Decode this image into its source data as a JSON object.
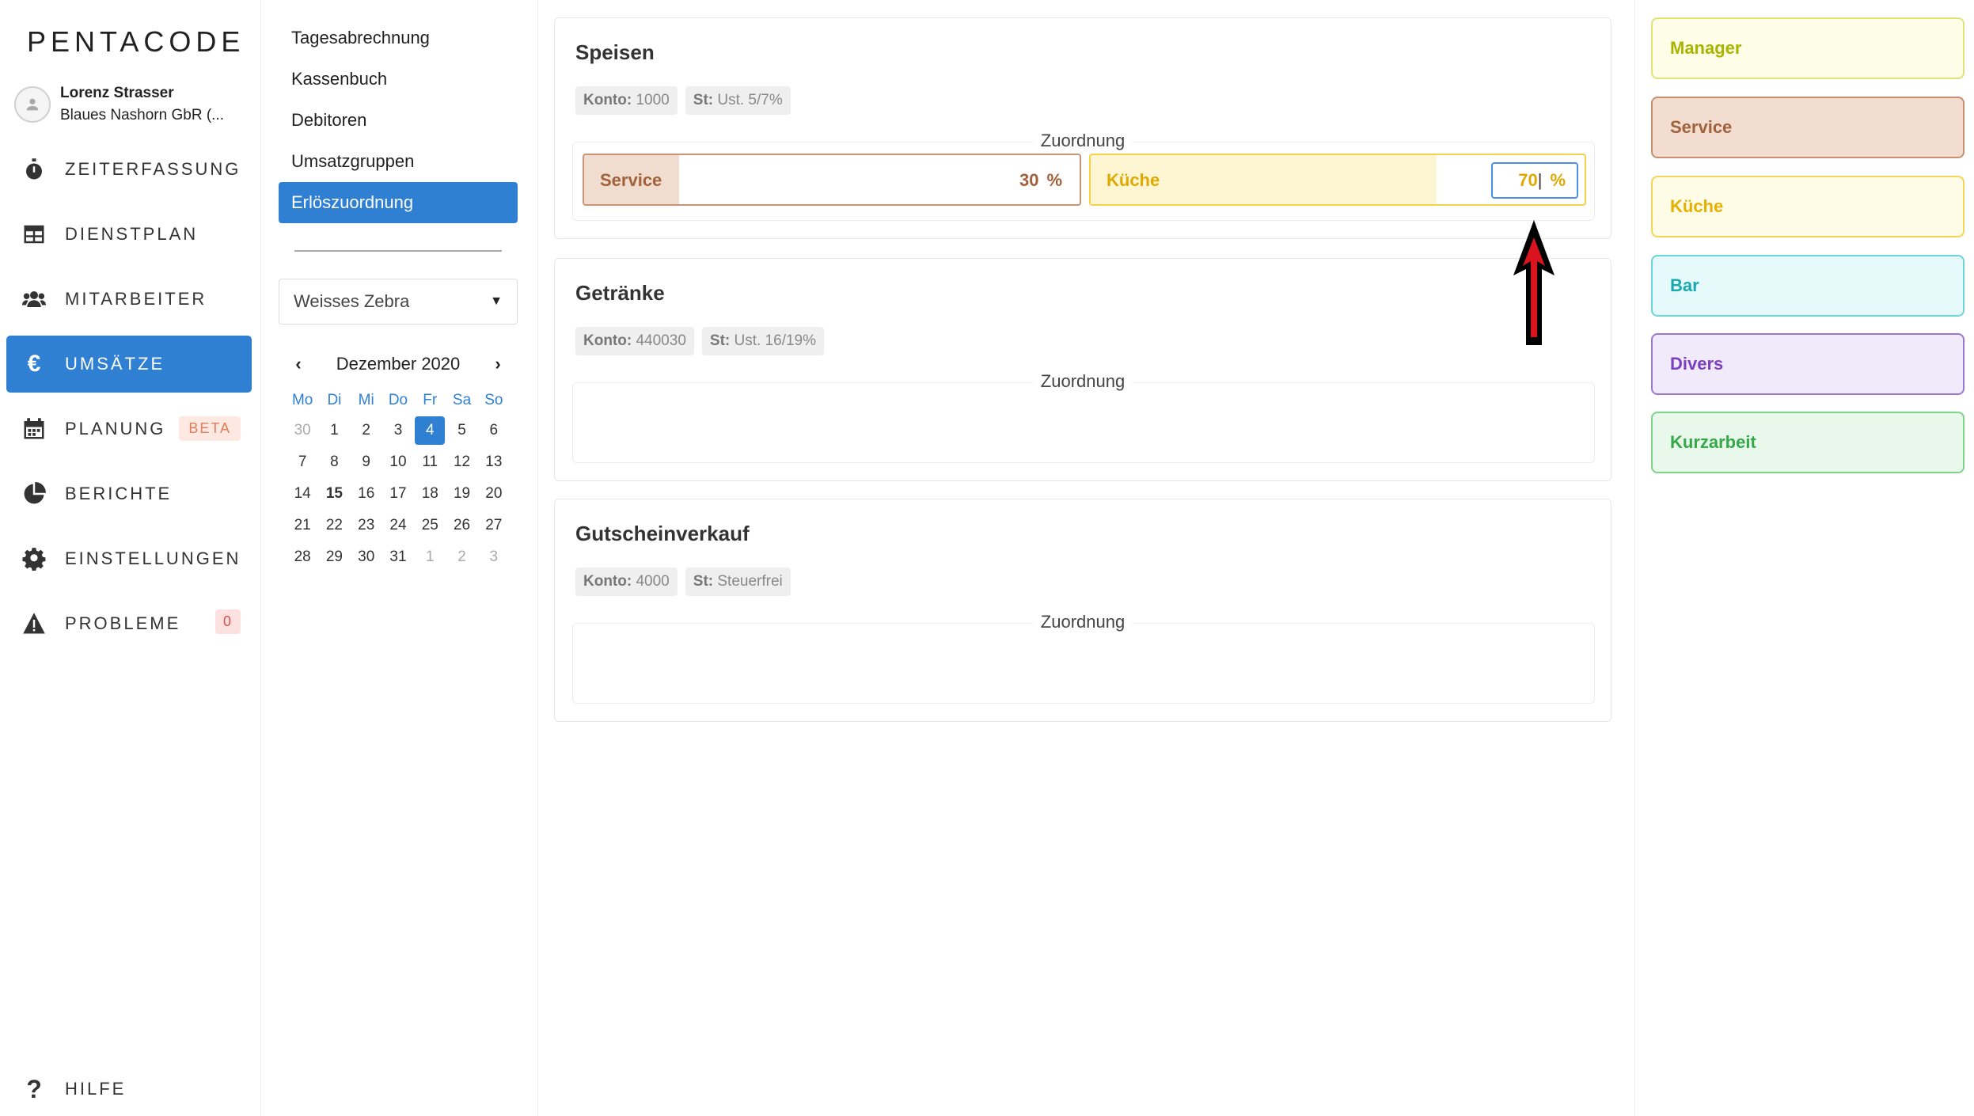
{
  "logo": "PENTACODE",
  "user": {
    "name": "Lorenz Strasser",
    "company": "Blaues Nashorn GbR (..."
  },
  "nav": {
    "items": [
      {
        "label": "ZEITERFASSUNG",
        "icon": "stopwatch-icon"
      },
      {
        "label": "DIENSTPLAN",
        "icon": "table-icon"
      },
      {
        "label": "MITARBEITER",
        "icon": "users-icon"
      },
      {
        "label": "UMSÄTZE",
        "icon": "euro-icon",
        "active": true
      },
      {
        "label": "PLANUNG",
        "icon": "calendar-icon",
        "badge": "BETA"
      },
      {
        "label": "BERICHTE",
        "icon": "pie-chart-icon"
      },
      {
        "label": "EINSTELLUNGEN",
        "icon": "gear-icon"
      },
      {
        "label": "PROBLEME",
        "icon": "warning-icon",
        "badge": "0"
      },
      {
        "label": "HILFE",
        "icon": "question-icon"
      }
    ]
  },
  "subnav": {
    "items": [
      "Tagesabrechnung",
      "Kassenbuch",
      "Debitoren",
      "Umsatzgruppen",
      "Erlöszuordnung"
    ],
    "active": "Erlöszuordnung"
  },
  "restaurant_select": {
    "value": "Weisses Zebra",
    "caret": "▼"
  },
  "calendar": {
    "month": "Dezember 2020",
    "prev": "‹",
    "next": "›",
    "weekdays": [
      "Mo",
      "Di",
      "Mi",
      "Do",
      "Fr",
      "Sa",
      "So"
    ],
    "weeks": [
      [
        "30",
        "1",
        "2",
        "3",
        "4",
        "5",
        "6"
      ],
      [
        "7",
        "8",
        "9",
        "10",
        "11",
        "12",
        "13"
      ],
      [
        "14",
        "15",
        "16",
        "17",
        "18",
        "19",
        "20"
      ],
      [
        "21",
        "22",
        "23",
        "24",
        "25",
        "26",
        "27"
      ],
      [
        "28",
        "29",
        "30",
        "31",
        "1",
        "2",
        "3"
      ]
    ],
    "selected": "4",
    "bold": "15"
  },
  "cards": [
    {
      "title": "Speisen",
      "konto_label": "Konto:",
      "konto": "1000",
      "st_label": "St:",
      "st": "Ust. 5/7%",
      "zuordnung": "Zuordnung",
      "allocations": [
        {
          "label": "Service",
          "value": "30",
          "unit": "%",
          "fill": 0.3,
          "color": "#a0613b",
          "bg": "#f0ddd0",
          "border": "#c89478"
        },
        {
          "label": "Küche",
          "value": "70",
          "unit": "%",
          "fill": 0.7,
          "color": "#e0a800",
          "bg": "#fef6d2",
          "border": "#f5d24a",
          "editing": true
        }
      ]
    },
    {
      "title": "Getränke",
      "konto_label": "Konto:",
      "konto": "440030",
      "st_label": "St:",
      "st": "Ust. 16/19%",
      "zuordnung": "Zuordnung"
    },
    {
      "title": "Gutscheinverkauf",
      "konto_label": "Konto:",
      "konto": "4000",
      "st_label": "St:",
      "st": "Steuerfrei",
      "zuordnung": "Zuordnung"
    }
  ],
  "groups": [
    {
      "label": "Manager",
      "color": "#a8b400",
      "bg": "#fdfde8",
      "border": "#dfe37a"
    },
    {
      "label": "Service",
      "color": "#a0613b",
      "bg": "#f2ddd0",
      "border": "#c58f70"
    },
    {
      "label": "Küche",
      "color": "#e5b100",
      "bg": "#fefbe6",
      "border": "#f2d65a"
    },
    {
      "label": "Bar",
      "color": "#1aa8b0",
      "bg": "#e6f9fa",
      "border": "#6cd3d8"
    },
    {
      "label": "Divers",
      "color": "#7b3fc2",
      "bg": "#f0eafb",
      "border": "#9a78d2"
    },
    {
      "label": "Kurzarbeit",
      "color": "#36a84a",
      "bg": "#e8f8ea",
      "border": "#7dd38a"
    }
  ]
}
